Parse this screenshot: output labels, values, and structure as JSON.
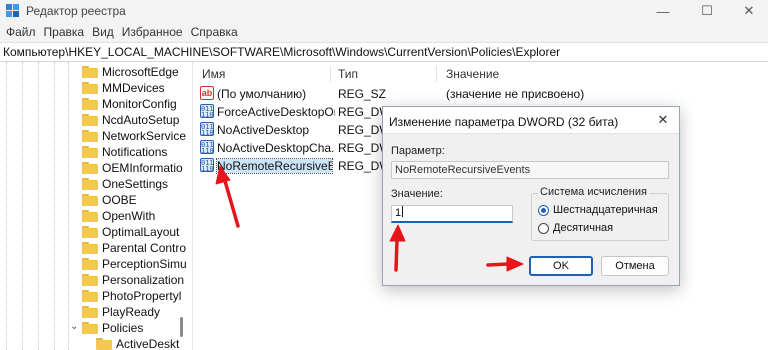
{
  "window": {
    "title": "Редактор реестра",
    "controls": {
      "minimize": "—",
      "maximize": "☐",
      "close": "✕"
    }
  },
  "menu": [
    "Файл",
    "Правка",
    "Вид",
    "Избранное",
    "Справка"
  ],
  "address": "Компьютер\\HKEY_LOCAL_MACHINE\\SOFTWARE\\Microsoft\\Windows\\CurrentVersion\\Policies\\Explorer",
  "tree": {
    "items": [
      "MicrosoftEdge",
      "MMDevices",
      "MonitorConfig",
      "NcdAutoSetup",
      "NetworkService",
      "Notifications",
      "OEMInformatio",
      "OneSettings",
      "OOBE",
      "OpenWith",
      "OptimalLayout",
      "Parental Contro",
      "PerceptionSimu",
      "Personalization",
      "PhotoPropertyl",
      "PlayReady",
      "Policies",
      "ActiveDeskt"
    ],
    "expand_glyph": "›",
    "collapse_glyph": "⌄"
  },
  "list": {
    "columns": {
      "name": "Имя",
      "type": "Тип",
      "value": "Значение"
    },
    "rows": [
      {
        "name": "(По умолчанию)",
        "type": "REG_SZ",
        "value": "(значение не присвоено)",
        "icon": "string-value-icon",
        "icon_text": "ab"
      },
      {
        "name": "ForceActiveDesktopOn",
        "type": "REG_DWORD",
        "value": "",
        "icon": "binary-value-icon",
        "icon_text": "011\n110"
      },
      {
        "name": "NoActiveDesktop",
        "type": "REG_DWORD",
        "value": "",
        "icon": "binary-value-icon",
        "icon_text": "011\n110"
      },
      {
        "name": "NoActiveDesktopCha...",
        "type": "REG_DWORD",
        "value": "",
        "icon": "binary-value-icon",
        "icon_text": "011\n110"
      },
      {
        "name": "NoRemoteRecursiveE...",
        "type": "REG_DWORD",
        "value": "",
        "icon": "binary-value-icon",
        "icon_text": "011\n110"
      }
    ]
  },
  "dialog": {
    "title": "Изменение параметра DWORD (32 бита)",
    "close": "✕",
    "param_label": "Параметр:",
    "param_value": "NoRemoteRecursiveEvents",
    "value_label": "Значение:",
    "value": "1",
    "base_group_label": "Система исчисления",
    "base_options": [
      {
        "label": "Шестнадцатеричная",
        "selected": true
      },
      {
        "label": "Десятичная",
        "selected": false
      }
    ],
    "ok_label": "OK",
    "cancel_label": "Отмена"
  },
  "colors": {
    "accent": "#1f5fb8",
    "annotation_arrow": "#e8141c",
    "selection": "#cce4f7"
  }
}
